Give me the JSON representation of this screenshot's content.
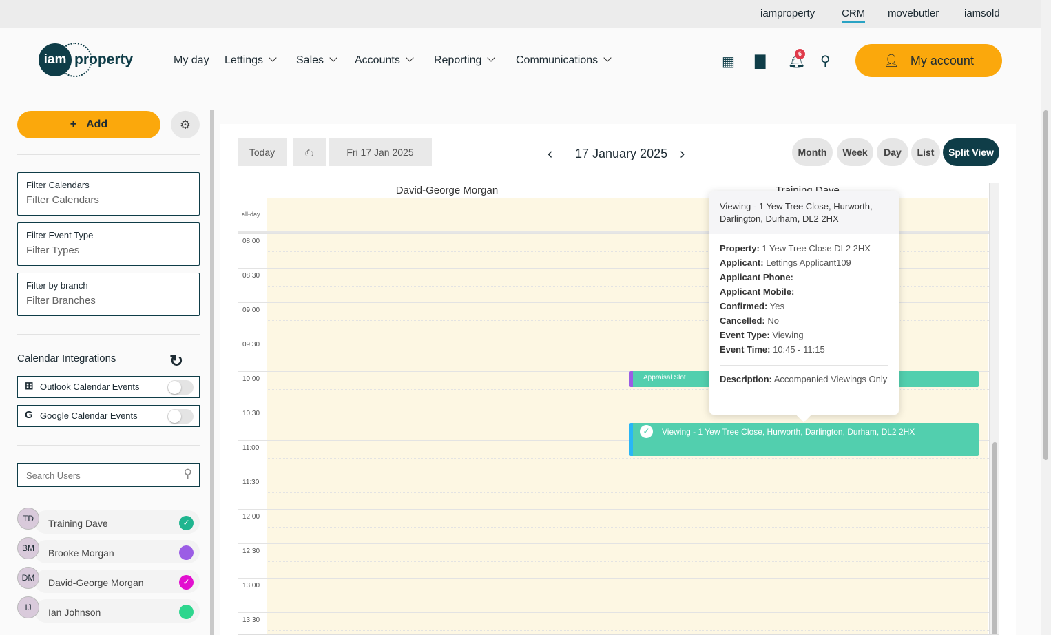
{
  "top_links": [
    "iamproperty",
    "CRM",
    "movebutler",
    "iamsold"
  ],
  "logo": {
    "mark": "iam",
    "text": "property"
  },
  "nav": [
    {
      "label": "My day",
      "dropdown": false
    },
    {
      "label": "Lettings",
      "dropdown": true
    },
    {
      "label": "Sales",
      "dropdown": true
    },
    {
      "label": "Accounts",
      "dropdown": true
    },
    {
      "label": "Reporting",
      "dropdown": true
    },
    {
      "label": "Communications",
      "dropdown": true
    }
  ],
  "notifications_count": "6",
  "account_label": "My account",
  "sidebar": {
    "add_label": "Add",
    "filters": [
      {
        "label": "Filter Calendars",
        "placeholder": "Filter Calendars"
      },
      {
        "label": "Filter Event Type",
        "placeholder": "Filter Types"
      },
      {
        "label": "Filter by branch",
        "placeholder": "Filter Branches"
      }
    ],
    "integrations_title": "Calendar Integrations",
    "integrations": [
      {
        "icon": "windows-icon",
        "label": "Outlook Calendar Events",
        "enabled": false
      },
      {
        "icon": "google-icon",
        "label": "Google Calendar Events",
        "enabled": false
      }
    ],
    "search_placeholder": "Search Users",
    "users": [
      {
        "initials": "TD",
        "name": "Training Dave",
        "color": "#1fb58f",
        "checked": true
      },
      {
        "initials": "BM",
        "name": "Brooke Morgan",
        "color": "#9b5de5",
        "checked": false
      },
      {
        "initials": "DM",
        "name": "David-George Morgan",
        "color": "#e20fcf",
        "checked": true
      },
      {
        "initials": "IJ",
        "name": "Ian Johnson",
        "color": "#2ed68e",
        "checked": false
      }
    ]
  },
  "toolbar": {
    "today": "Today",
    "date_button": "Fri 17 Jan 2025",
    "title": "17 January 2025",
    "views": [
      "Month",
      "Week",
      "Day",
      "List",
      "Split View"
    ],
    "active_view": "Split View"
  },
  "calendar": {
    "all_day_label": "all-day",
    "columns": [
      "David-George Morgan",
      "Training Dave"
    ],
    "times": [
      "08:00",
      "08:30",
      "09:00",
      "09:30",
      "10:00",
      "10:30",
      "11:00",
      "11:30",
      "12:00",
      "12:30",
      "13:00",
      "13:30"
    ],
    "events": [
      {
        "title": "Appraisal Slot",
        "column": 1,
        "start": "10:00",
        "end": "10:15",
        "accent": "#9b5de5"
      },
      {
        "title": "Viewing - 1 Yew Tree Close, Hurworth, Darlington, Durham, DL2 2HX",
        "column": 1,
        "start": "10:45",
        "end": "11:15",
        "accent": "#29b6f6",
        "confirmed": true
      }
    ]
  },
  "tooltip": {
    "title": "Viewing - 1 Yew Tree Close, Hurworth, Darlington, Durham, DL2 2HX",
    "fields": [
      {
        "k": "Property:",
        "v": "1 Yew Tree Close DL2 2HX"
      },
      {
        "k": "Applicant:",
        "v": "Lettings Applicant109"
      },
      {
        "k": "Applicant Phone:",
        "v": ""
      },
      {
        "k": "Applicant Mobile:",
        "v": ""
      },
      {
        "k": "Confirmed:",
        "v": "Yes"
      },
      {
        "k": "Cancelled:",
        "v": "No"
      },
      {
        "k": "Event Type:",
        "v": "Viewing"
      },
      {
        "k": "Event Time:",
        "v": "10:45 - 11:15"
      }
    ],
    "description_key": "Description:",
    "description": "Accompanied Viewings Only"
  }
}
